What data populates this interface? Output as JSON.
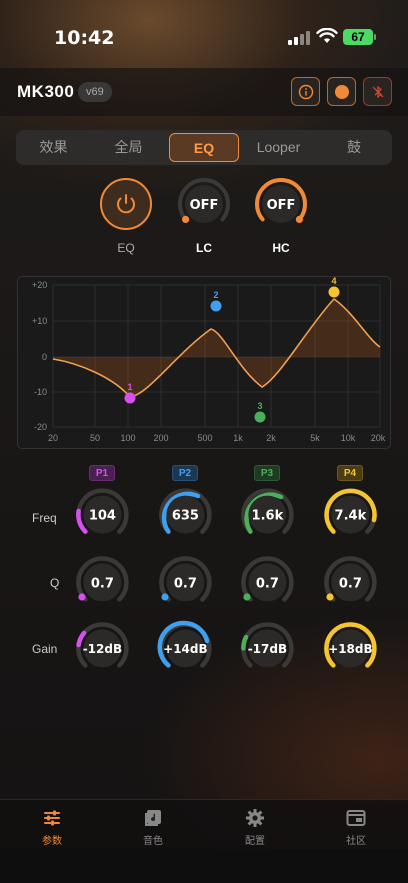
{
  "status_bar": {
    "time": "10:42",
    "battery": "67"
  },
  "header": {
    "title": "MK300",
    "version": "v69"
  },
  "tabs": [
    {
      "label": "效果"
    },
    {
      "label": "全局"
    },
    {
      "label": "EQ"
    },
    {
      "label": "Looper"
    },
    {
      "label": "鼓"
    }
  ],
  "active_tab": "EQ",
  "switches": {
    "eq": {
      "label": "EQ",
      "state": "on"
    },
    "lc": {
      "label": "LC",
      "value": "OFF"
    },
    "hc": {
      "label": "HC",
      "value": "OFF"
    }
  },
  "graph": {
    "y_ticks": [
      "+20",
      "+10",
      "0",
      "-10",
      "-20"
    ],
    "x_ticks": [
      "20",
      "50",
      "100",
      "200",
      "500",
      "1k",
      "2k",
      "5k",
      "10k",
      "20k"
    ],
    "points": [
      "1",
      "2",
      "3",
      "4"
    ]
  },
  "rows": {
    "freq": "Freq",
    "q": "Q",
    "gain": "Gain"
  },
  "bands": [
    {
      "name": "P1",
      "color": "#d94ef0",
      "freq": "104",
      "q": "0.7",
      "gain": "-12dB"
    },
    {
      "name": "P2",
      "color": "#3fa0ef",
      "freq": "635",
      "q": "0.7",
      "gain": "+14dB"
    },
    {
      "name": "P3",
      "color": "#4caf5a",
      "freq": "1.6k",
      "q": "0.7",
      "gain": "-17dB"
    },
    {
      "name": "P4",
      "color": "#f5c431",
      "freq": "7.4k",
      "q": "0.7",
      "gain": "+18dB"
    }
  ],
  "bottom_nav": [
    {
      "label": "参数",
      "icon": "sliders-icon"
    },
    {
      "label": "音色",
      "icon": "music-note-icon"
    },
    {
      "label": "配置",
      "icon": "gear-icon"
    },
    {
      "label": "社区",
      "icon": "community-icon"
    }
  ],
  "colors": {
    "accent": "#f08a38",
    "bg": "#151313"
  }
}
